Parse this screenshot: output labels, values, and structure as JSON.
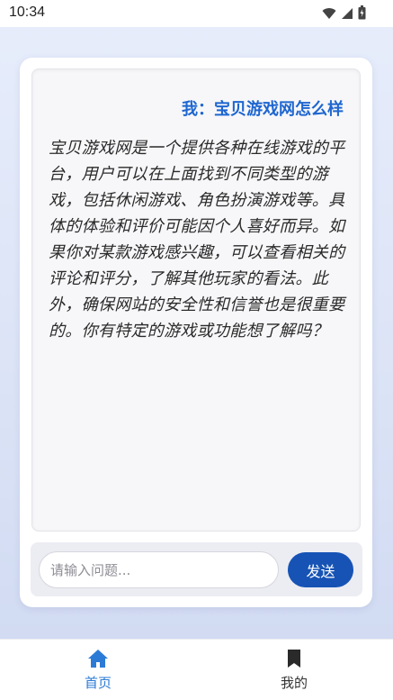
{
  "status_bar": {
    "time": "10:34",
    "icons": [
      "wifi-icon",
      "cellular-signal-icon",
      "battery-icon"
    ]
  },
  "chat": {
    "question": "我：宝贝游戏网怎么样",
    "answer": "宝贝游戏网是一个提供各种在线游戏的平台，用户可以在上面找到不同类型的游戏，包括休闲游戏、角色扮演游戏等。具体的体验和评价可能因个人喜好而异。如果你对某款游戏感兴趣，可以查看相关的评论和评分，了解其他玩家的看法。此外，确保网站的安全性和信誉也是很重要的。你有特定的游戏或功能想了解吗？"
  },
  "input": {
    "placeholder": "请输入问题...",
    "value": "",
    "send_label": "发送"
  },
  "bottom_nav": {
    "items": [
      {
        "label": "首页",
        "icon": "home-icon",
        "active": true
      },
      {
        "label": "我的",
        "icon": "bookmark-icon",
        "active": false
      }
    ]
  },
  "colors": {
    "accent": "#1e66d0",
    "send_button": "#1653b5",
    "nav_active": "#2b7bd6",
    "background": "#dbe3f6"
  }
}
